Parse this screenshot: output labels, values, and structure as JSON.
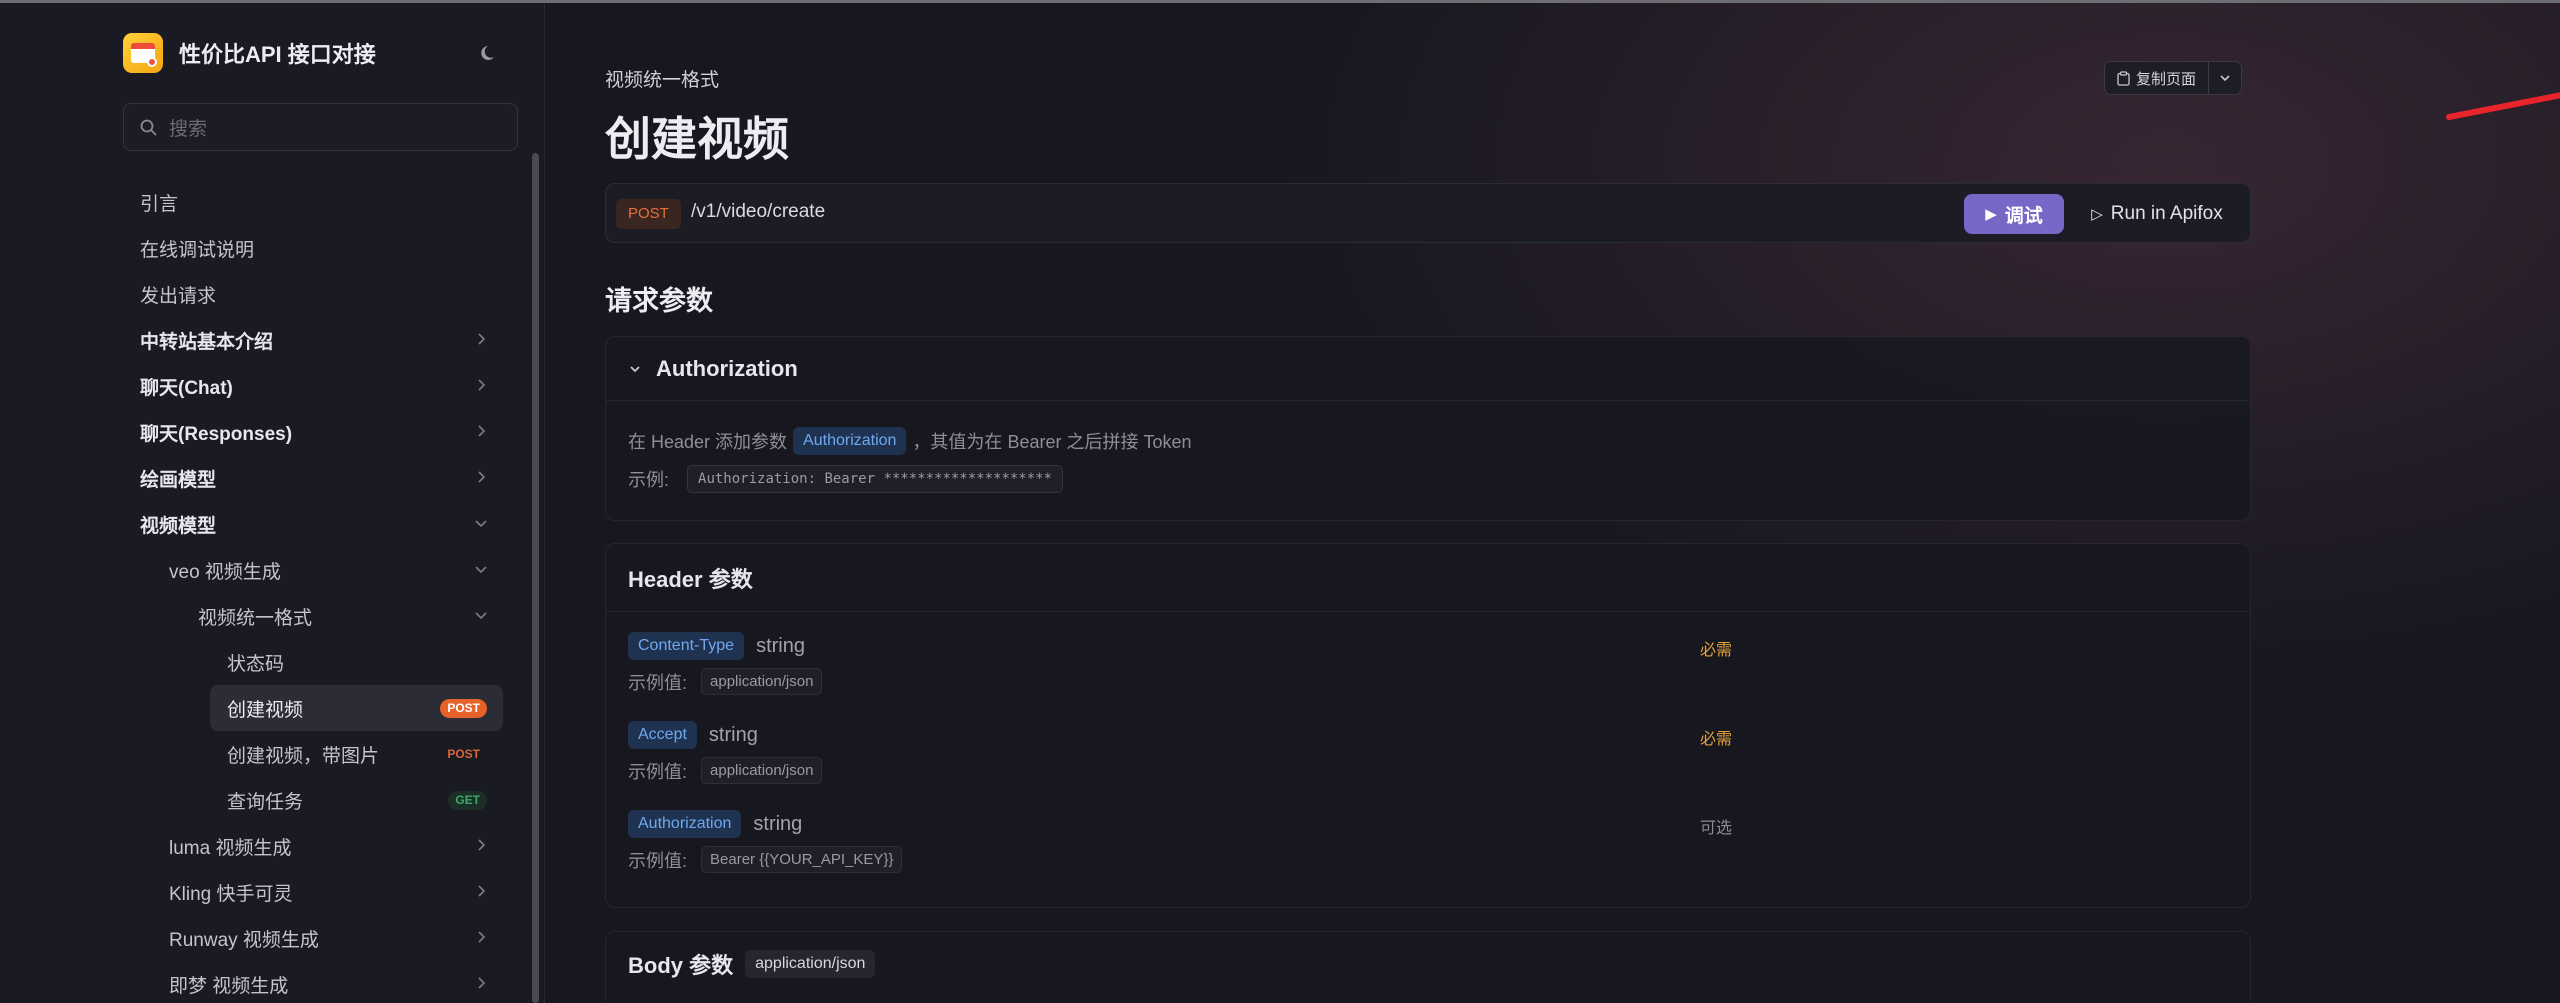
{
  "brand": {
    "title": "性价比API 接口对接"
  },
  "search": {
    "placeholder": "搜索"
  },
  "sidebar": {
    "items": [
      {
        "label": "引言"
      },
      {
        "label": "在线调试说明"
      },
      {
        "label": "发出请求"
      },
      {
        "label": "中转站基本介绍"
      },
      {
        "label": "聊天(Chat)"
      },
      {
        "label": "聊天(Responses)"
      },
      {
        "label": "绘画模型"
      },
      {
        "label": "视频模型"
      },
      {
        "label": "veo 视频生成"
      },
      {
        "label": "视频统一格式"
      },
      {
        "label": "状态码"
      },
      {
        "label": "创建视频",
        "badge": "POST"
      },
      {
        "label": "创建视频，带图片",
        "badge": "POST"
      },
      {
        "label": "查询任务",
        "badge": "GET"
      },
      {
        "label": "luma 视频生成"
      },
      {
        "label": "Kling 快手可灵"
      },
      {
        "label": "Runway 视频生成"
      },
      {
        "label": "即梦 视频生成"
      }
    ]
  },
  "main": {
    "breadcrumb": "视频统一格式",
    "title": "创建视频",
    "copy_label": "复制页面",
    "method": "POST",
    "path": "/v1/video/create",
    "debug_label": "调试",
    "apifox_label": "Run in Apifox",
    "section_title": "请求参数"
  },
  "auth": {
    "title": "Authorization",
    "desc_prefix": "在 Header 添加参数",
    "desc_tag": "Authorization",
    "desc_suffix": "，其值为在 Bearer 之后拼接 Token",
    "example_label": "示例:",
    "example_value": "Authorization: Bearer ********************"
  },
  "header_params": {
    "title": "Header 参数",
    "example_label": "示例值:",
    "items": [
      {
        "name": "Content-Type",
        "type": "string",
        "flag": "必需",
        "example": "application/json"
      },
      {
        "name": "Accept",
        "type": "string",
        "flag": "必需",
        "example": "application/json"
      },
      {
        "name": "Authorization",
        "type": "string",
        "flag": "可选",
        "example": "Bearer {{YOUR_API_KEY}}"
      }
    ]
  },
  "body_params": {
    "title": "Body 参数",
    "content_type": "application/json"
  },
  "colors": {
    "accent": "#7967c8",
    "post": "#e5622b",
    "get": "#3fa56f",
    "required": "#e6a23c",
    "annotation_arrow": "#e8252a"
  }
}
